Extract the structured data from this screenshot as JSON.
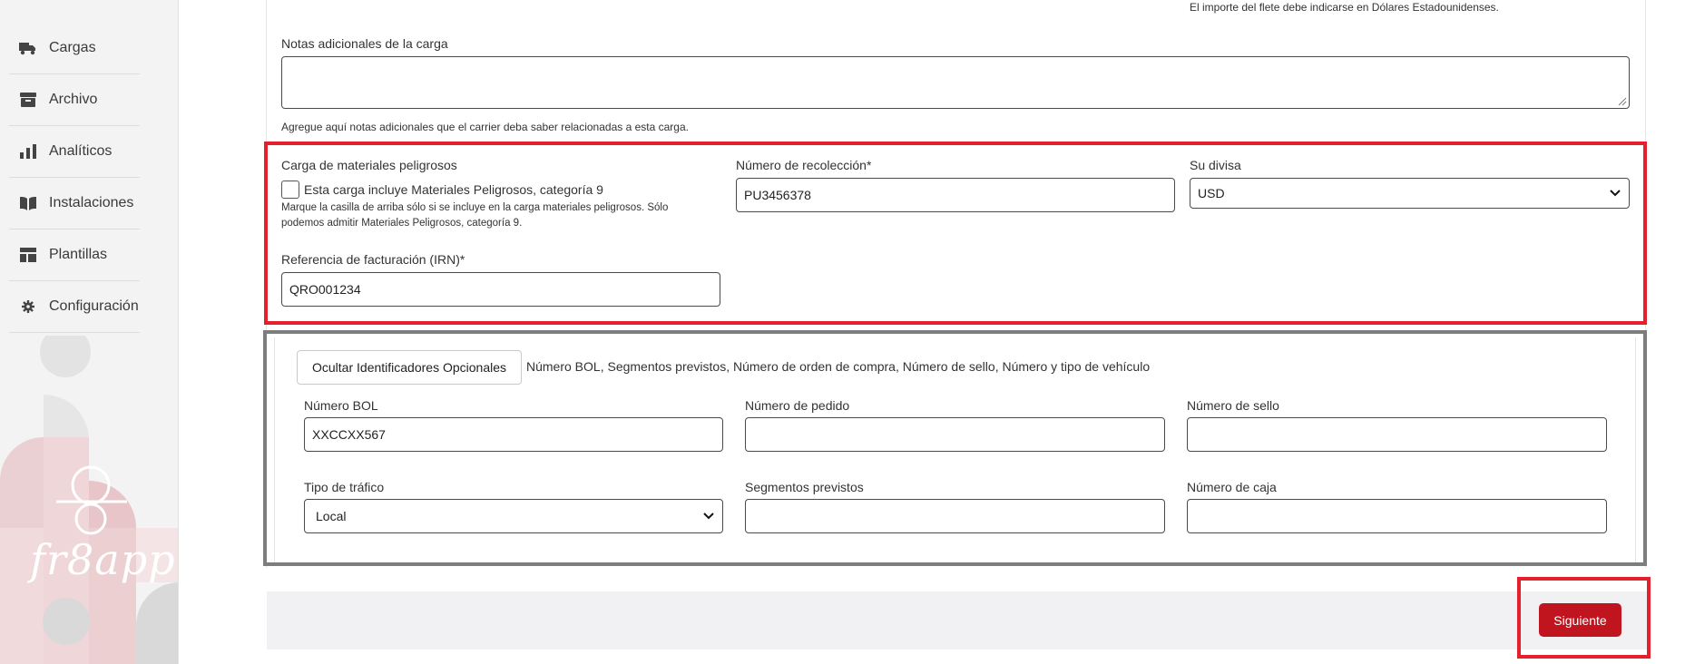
{
  "sidebar": {
    "items": [
      {
        "label": "Cargas",
        "icon": "truck-icon"
      },
      {
        "label": "Archivo",
        "icon": "archive-box-icon"
      },
      {
        "label": "Analíticos",
        "icon": "bar-chart-icon"
      },
      {
        "label": "Instalaciones",
        "icon": "book-icon"
      },
      {
        "label": "Plantillas",
        "icon": "template-icon"
      },
      {
        "label": "Configuración",
        "icon": "gear-icon"
      }
    ]
  },
  "form": {
    "freight_hint": "El importe del flete debe indicarse en Dólares Estadounidenses.",
    "notes_label": "Notas adicionales de la carga",
    "notes_value": "",
    "notes_hint": "Agregue aquí notas adicionales que el carrier deba saber relacionadas a esta carga.",
    "hazmat_label": "Carga de materiales peligrosos",
    "hazmat_checkbox_label": "Esta carga incluye Materiales Peligrosos, categoría 9",
    "hazmat_checked": false,
    "hazmat_hint_1": "Marque la casilla de arriba sólo si se incluye en la carga materiales peligrosos. Sólo",
    "hazmat_hint_2": "podemos admitir Materiales Peligrosos, categoría 9.",
    "pickup_label": "Número de recolección*",
    "pickup_value": "PU3456378",
    "currency_label": "Su divisa",
    "currency_value": "USD",
    "billing_label": "Referencia de facturación (IRN)*",
    "billing_value": "QRO001234"
  },
  "optional": {
    "toggle_button": "Ocultar Identificadores Opcionales",
    "summary": "Número BOL, Segmentos previstos, Número de orden de compra, Número de sello, Número y tipo de vehículo",
    "bol_label": "Número BOL",
    "bol_value": "XXCCXX567",
    "order_label": "Número de pedido",
    "order_value": "",
    "seal_label": "Número de sello",
    "seal_value": "",
    "traffic_label": "Tipo de tráfico",
    "traffic_value": "Local",
    "segments_label": "Segmentos previstos",
    "segments_value": "",
    "box_label": "Número de caja",
    "box_value": ""
  },
  "footer": {
    "next_button": "Siguiente"
  },
  "brand": {
    "logo_text": "fr8app",
    "accent": "#c0141f",
    "highlight": "#e3202b",
    "frame_gray": "#7d7d7d"
  }
}
